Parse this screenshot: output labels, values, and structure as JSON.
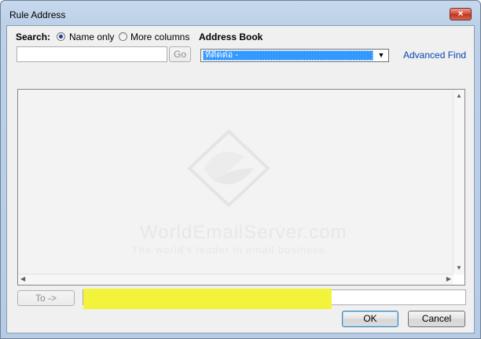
{
  "window": {
    "title": "Rule Address",
    "close_label": "×"
  },
  "search": {
    "label": "Search:",
    "option_name_only": "Name only",
    "option_more_columns": "More columns",
    "selected": "Name only",
    "input_value": "",
    "go_label": "Go"
  },
  "address_book": {
    "label": "Address Book",
    "selected_value": "ที่ติดต่อ -"
  },
  "advanced_find": "Advanced Find",
  "watermark": {
    "site": "WorldEmailServer.com",
    "tagline": "The world's leader in email business"
  },
  "to_button": "To ->",
  "to_value": "",
  "ok_label": "OK",
  "cancel_label": "Cancel",
  "colors": {
    "highlight": "#f4f33b",
    "selection": "#3399ff",
    "link": "#0645ad"
  }
}
